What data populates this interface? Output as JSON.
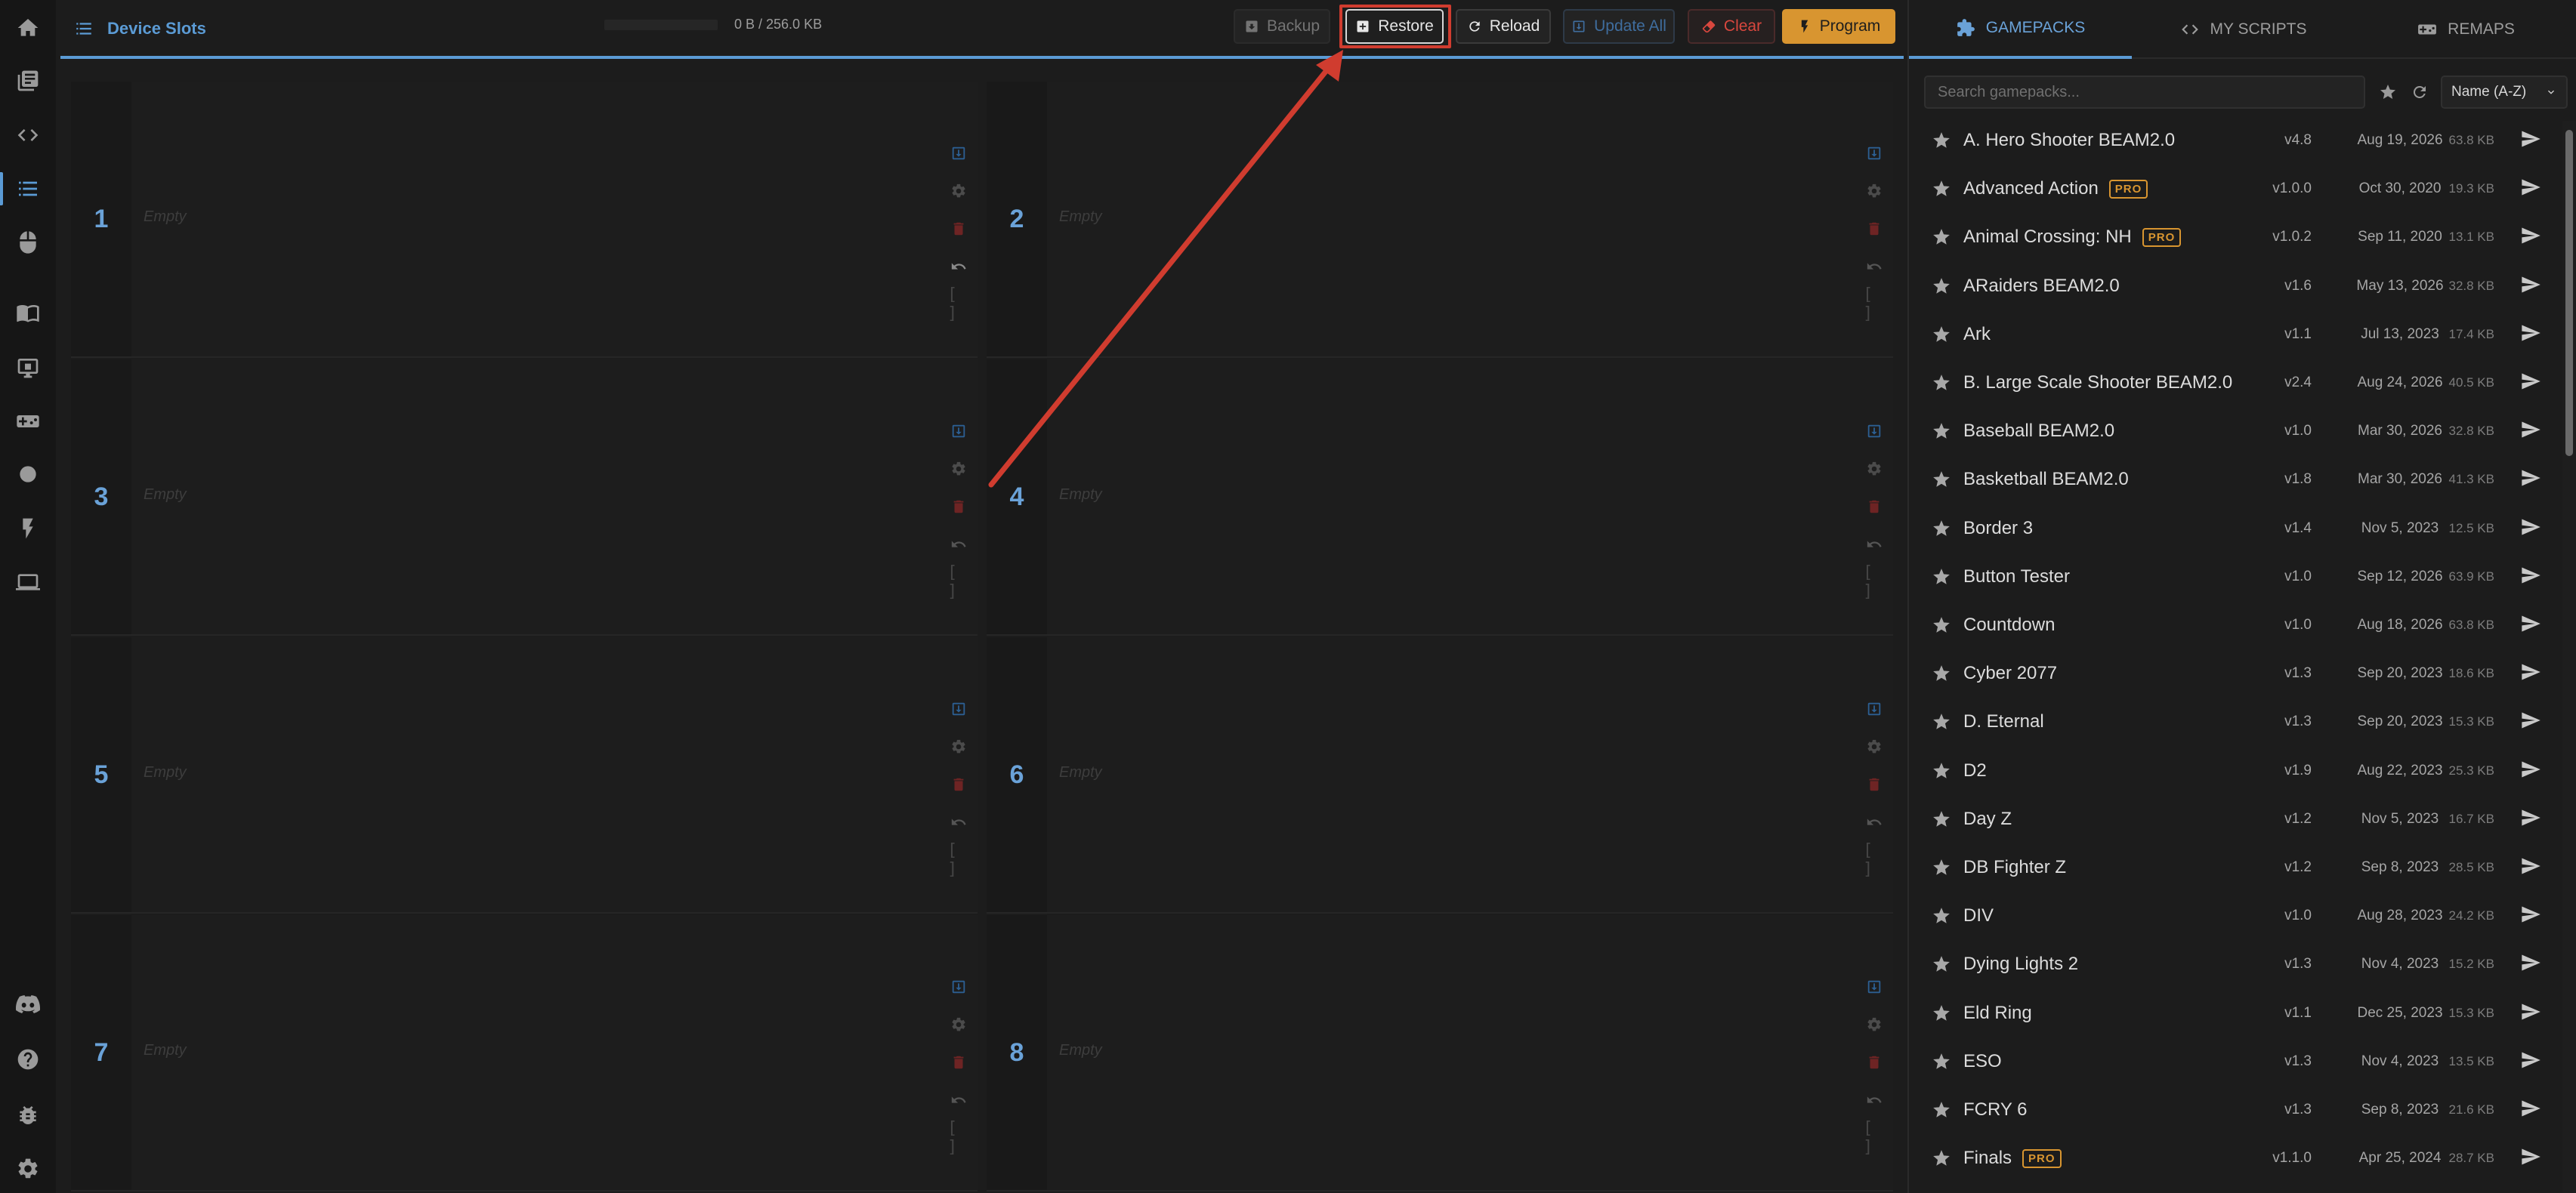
{
  "topbar": {
    "title": "Device Slots",
    "memory": "0 B / 256.0 KB",
    "buttons": {
      "backup": "Backup",
      "restore": "Restore",
      "reload": "Reload",
      "update_all": "Update All",
      "clear": "Clear",
      "program": "Program"
    }
  },
  "slots": [
    {
      "num": "1",
      "label": "Empty"
    },
    {
      "num": "2",
      "label": "Empty"
    },
    {
      "num": "3",
      "label": "Empty"
    },
    {
      "num": "4",
      "label": "Empty"
    },
    {
      "num": "5",
      "label": "Empty"
    },
    {
      "num": "6",
      "label": "Empty"
    },
    {
      "num": "7",
      "label": "Empty"
    },
    {
      "num": "8",
      "label": "Empty"
    }
  ],
  "panel": {
    "tabs": {
      "gamepacks": "GAMEPACKS",
      "my_scripts": "MY SCRIPTS",
      "remaps": "REMAPS"
    },
    "search_placeholder": "Search gamepacks...",
    "sort": "Name (A-Z)",
    "pro_label": "PRO",
    "gamepacks": [
      {
        "name": "A. Hero Shooter BEAM2.0",
        "version": "v4.8",
        "date": "Aug 19, 2026",
        "size": "63.8 KB",
        "pro": false
      },
      {
        "name": "Advanced Action",
        "version": "v1.0.0",
        "date": "Oct 30, 2020",
        "size": "19.3 KB",
        "pro": true
      },
      {
        "name": "Animal Crossing: NH",
        "version": "v1.0.2",
        "date": "Sep 11, 2020",
        "size": "13.1 KB",
        "pro": true
      },
      {
        "name": "ARaiders BEAM2.0",
        "version": "v1.6",
        "date": "May 13, 2026",
        "size": "32.8 KB",
        "pro": false
      },
      {
        "name": "Ark",
        "version": "v1.1",
        "date": "Jul 13, 2023",
        "size": "17.4 KB",
        "pro": false
      },
      {
        "name": "B. Large Scale Shooter BEAM2.0",
        "version": "v2.4",
        "date": "Aug 24, 2026",
        "size": "40.5 KB",
        "pro": false
      },
      {
        "name": "Baseball BEAM2.0",
        "version": "v1.0",
        "date": "Mar 30, 2026",
        "size": "32.8 KB",
        "pro": false
      },
      {
        "name": "Basketball BEAM2.0",
        "version": "v1.8",
        "date": "Mar 30, 2026",
        "size": "41.3 KB",
        "pro": false
      },
      {
        "name": "Border 3",
        "version": "v1.4",
        "date": "Nov 5, 2023",
        "size": "12.5 KB",
        "pro": false
      },
      {
        "name": "Button Tester",
        "version": "v1.0",
        "date": "Sep 12, 2026",
        "size": "63.9 KB",
        "pro": false
      },
      {
        "name": "Countdown",
        "version": "v1.0",
        "date": "Aug 18, 2026",
        "size": "63.8 KB",
        "pro": false
      },
      {
        "name": "Cyber 2077",
        "version": "v1.3",
        "date": "Sep 20, 2023",
        "size": "18.6 KB",
        "pro": false
      },
      {
        "name": "D. Eternal",
        "version": "v1.3",
        "date": "Sep 20, 2023",
        "size": "15.3 KB",
        "pro": false
      },
      {
        "name": "D2",
        "version": "v1.9",
        "date": "Aug 22, 2023",
        "size": "25.3 KB",
        "pro": false
      },
      {
        "name": "Day Z",
        "version": "v1.2",
        "date": "Nov 5, 2023",
        "size": "16.7 KB",
        "pro": false
      },
      {
        "name": "DB Fighter Z",
        "version": "v1.2",
        "date": "Sep 8, 2023",
        "size": "28.5 KB",
        "pro": false
      },
      {
        "name": "DIV",
        "version": "v1.0",
        "date": "Aug 28, 2023",
        "size": "24.2 KB",
        "pro": false
      },
      {
        "name": "Dying Lights 2",
        "version": "v1.3",
        "date": "Nov 4, 2023",
        "size": "15.2 KB",
        "pro": false
      },
      {
        "name": "Eld Ring",
        "version": "v1.1",
        "date": "Dec 25, 2023",
        "size": "15.3 KB",
        "pro": false
      },
      {
        "name": "ESO",
        "version": "v1.3",
        "date": "Nov 4, 2023",
        "size": "13.5 KB",
        "pro": false
      },
      {
        "name": "FCRY 6",
        "version": "v1.3",
        "date": "Sep 8, 2023",
        "size": "21.6 KB",
        "pro": false
      },
      {
        "name": "Finals",
        "version": "v1.1.0",
        "date": "Apr 25, 2024",
        "size": "28.7 KB",
        "pro": true
      }
    ]
  },
  "colors": {
    "accent": "#5b9bd5",
    "program": "#d89530",
    "clear": "#d9473e",
    "annotation": "#d03c2f"
  }
}
